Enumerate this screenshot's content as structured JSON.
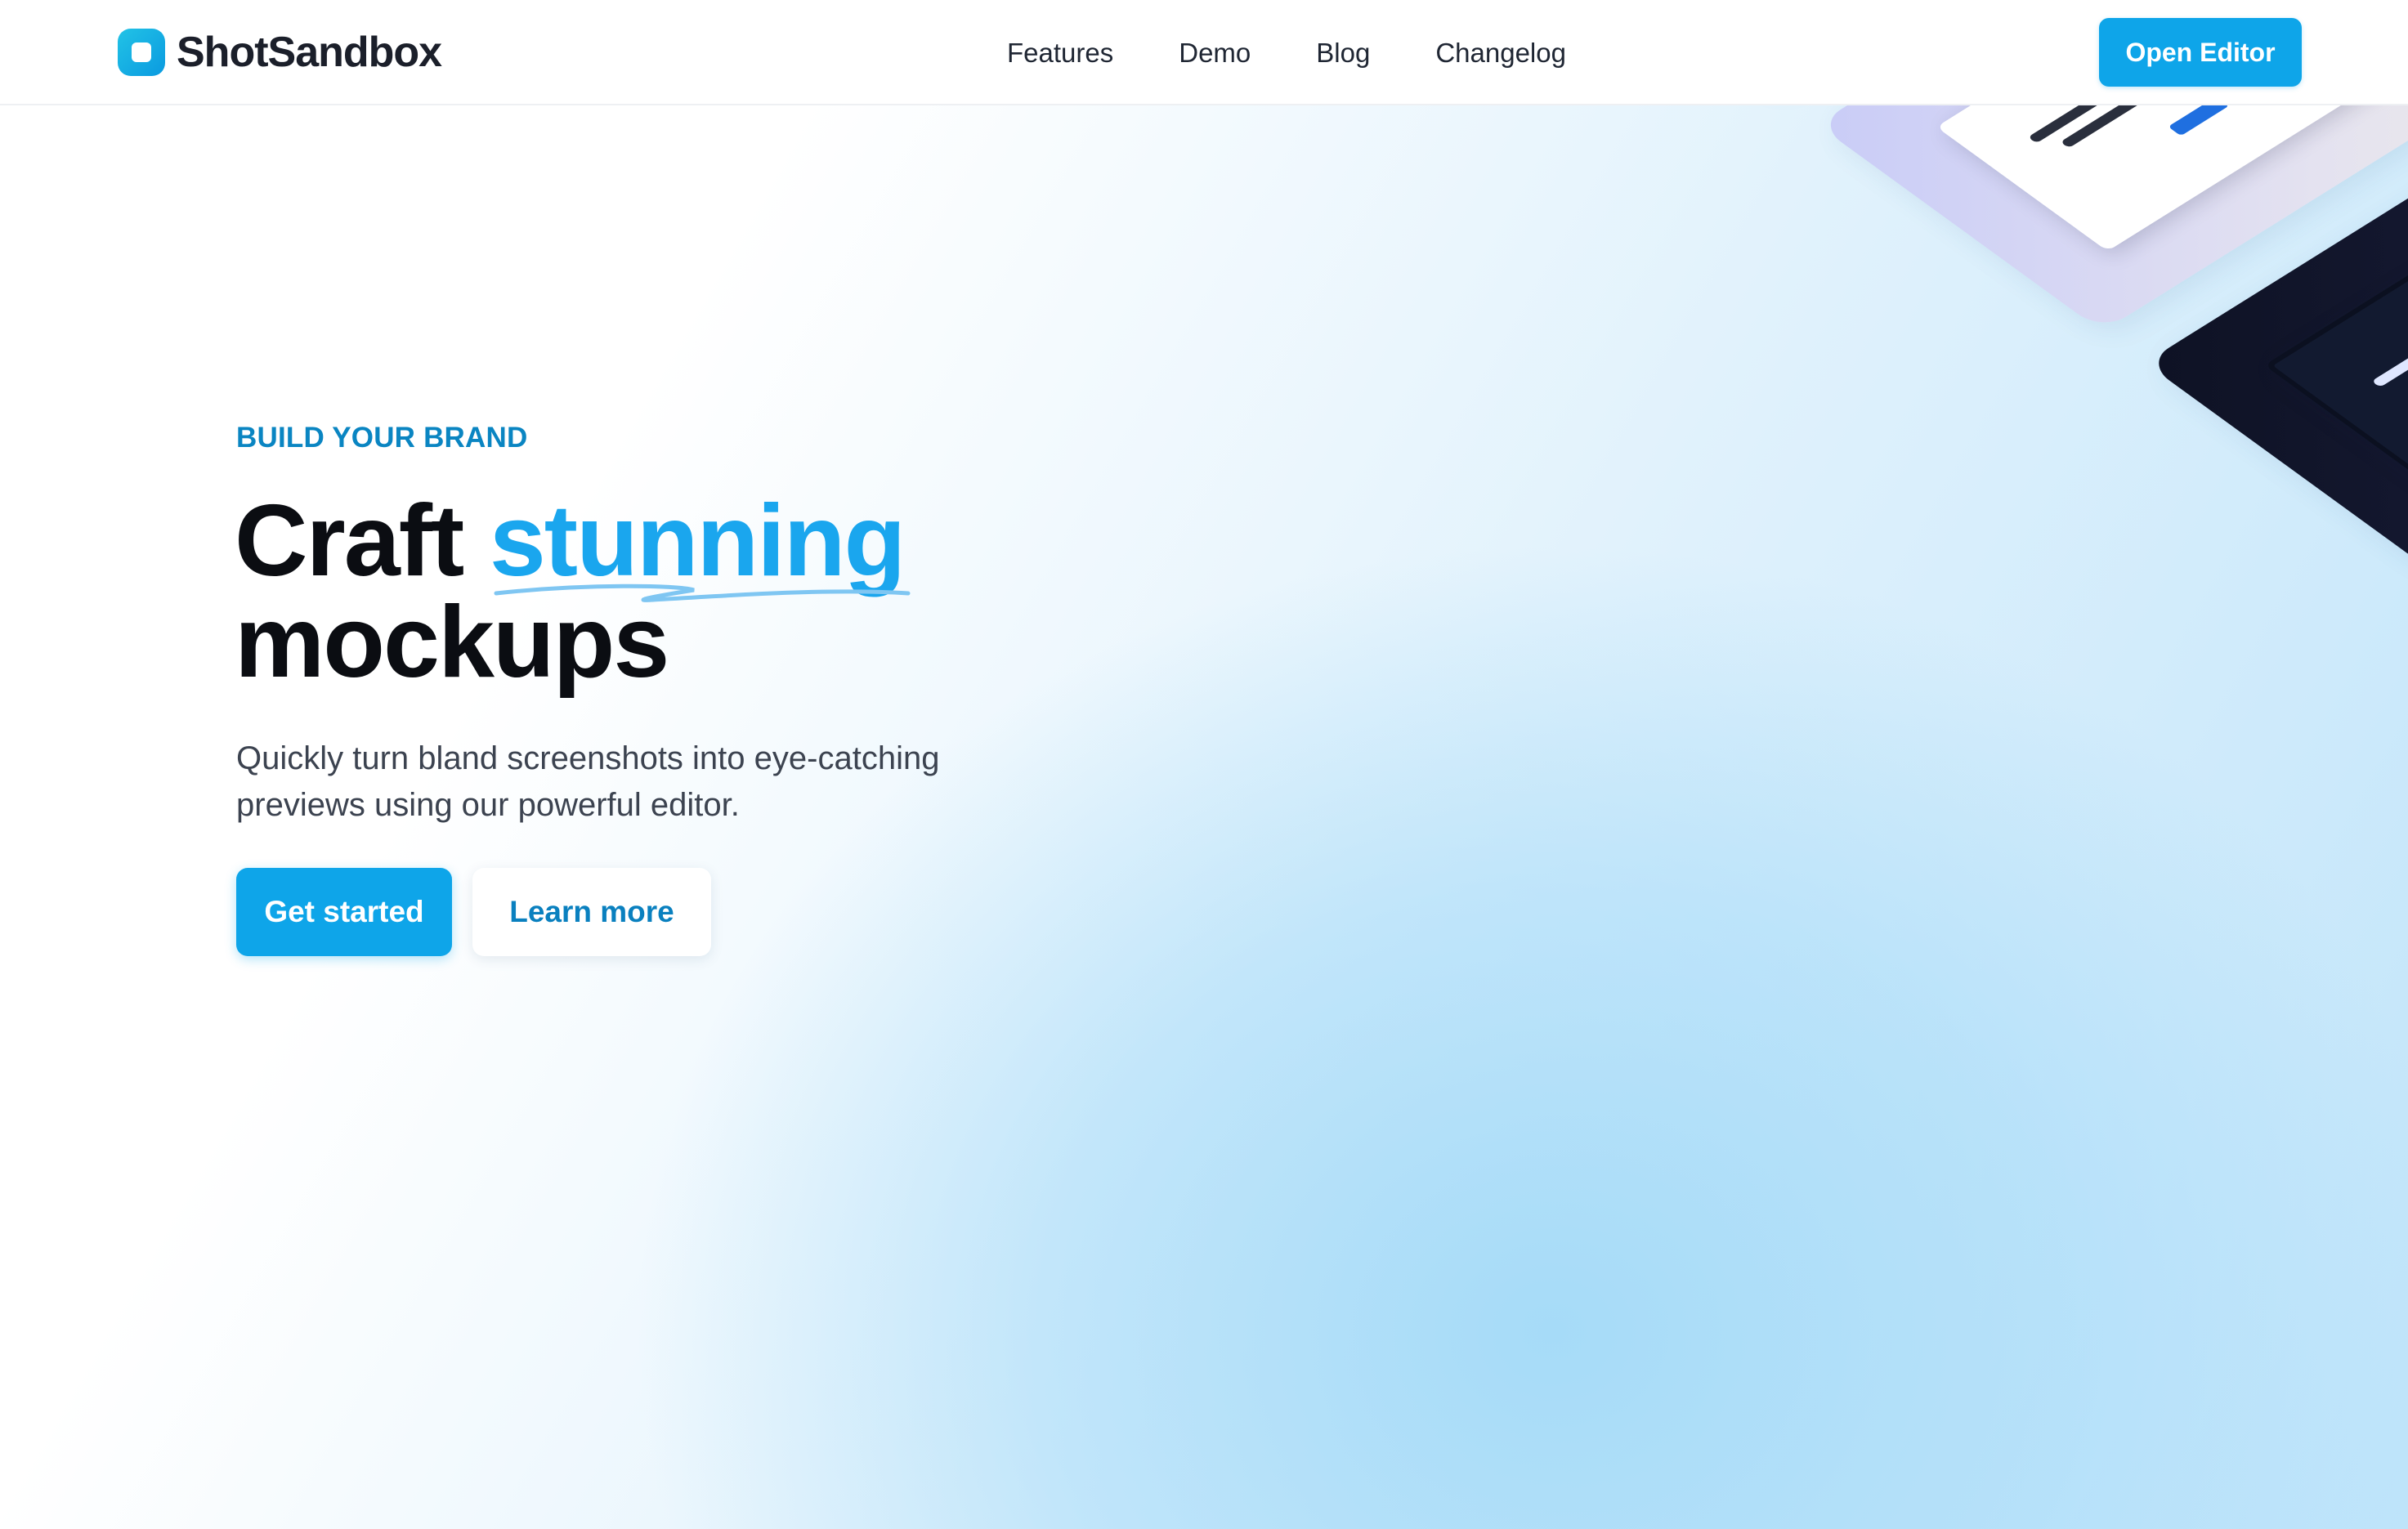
{
  "header": {
    "brand": "ShotSandbox",
    "nav": [
      {
        "label": "Features"
      },
      {
        "label": "Demo"
      },
      {
        "label": "Blog"
      },
      {
        "label": "Changelog"
      }
    ],
    "cta_label": "Open Editor"
  },
  "hero": {
    "eyebrow": "BUILD YOUR BRAND",
    "headline_start": "Craft",
    "headline_accent": "stunning",
    "headline_end": "mockups",
    "lede": "Quickly turn bland screenshots into eye-catching previews using our powerful editor.",
    "primary_label": "Get started",
    "secondary_label": "Learn more"
  },
  "colors": {
    "accent": "#0ea5e9",
    "eyebrow": "#0a85c2",
    "headline_accent": "#1aa6ee"
  }
}
